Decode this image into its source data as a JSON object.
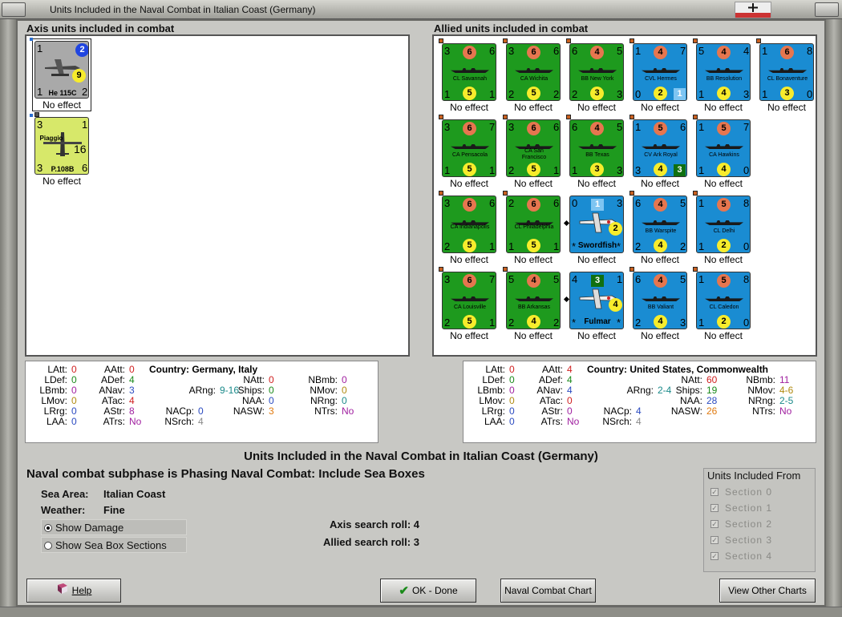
{
  "window": {
    "title": "Units Included in the Naval Combat in Italian Coast (Germany)"
  },
  "axis_section": {
    "title": "Axis units included in combat"
  },
  "allied_section": {
    "title": "Allied units included in combat"
  },
  "axis_units": [
    {
      "name": "He 115C",
      "tl": "1",
      "tr": "2",
      "bl": "1",
      "br": "2",
      "center": "9",
      "status": "No effect"
    },
    {
      "name": "P.108B",
      "name2": "Piaggio",
      "tl": "3",
      "tr": "1",
      "bl": "3",
      "br": "6",
      "center": "16",
      "status": "No effect"
    }
  ],
  "allied_units": [
    {
      "name": "CL Savannah",
      "tl": "3",
      "top": "6",
      "tr": "6",
      "bl": "1",
      "bot": "5",
      "br": "1",
      "status": "No effect"
    },
    {
      "name": "CA Wichita",
      "tl": "3",
      "top": "6",
      "tr": "6",
      "bl": "2",
      "bot": "5",
      "br": "2",
      "status": "No effect"
    },
    {
      "name": "BB New York",
      "tl": "6",
      "top": "4",
      "tr": "5",
      "bl": "2",
      "bot": "3",
      "br": "3",
      "status": "No effect"
    },
    {
      "name": "CVL Hermes",
      "tl": "1",
      "top": "4",
      "tr": "7",
      "bl": "0",
      "bot": "2",
      "br": "1",
      "status": "No effect"
    },
    {
      "name": "BB Resolution",
      "tl": "5",
      "top": "4",
      "tr": "4",
      "bl": "1",
      "bot": "4",
      "br": "3",
      "status": "No effect"
    },
    {
      "name": "CL Bonaventure",
      "tl": "1",
      "top": "6",
      "tr": "8",
      "bl": "1",
      "bot": "3",
      "br": "0",
      "status": "No effect"
    },
    {
      "name": "CA Pensacola",
      "tl": "3",
      "top": "6",
      "tr": "7",
      "bl": "1",
      "bot": "5",
      "br": "1",
      "status": "No effect"
    },
    {
      "name": "CA San Francisco",
      "tl": "3",
      "top": "6",
      "tr": "6",
      "bl": "2",
      "bot": "5",
      "br": "1",
      "status": "No effect"
    },
    {
      "name": "BB Texas",
      "tl": "6",
      "top": "4",
      "tr": "5",
      "bl": "1",
      "bot": "3",
      "br": "3",
      "status": "No effect"
    },
    {
      "name": "CV Ark Royal",
      "tl": "1",
      "top": "5",
      "tr": "6",
      "bl": "3",
      "bot": "4",
      "br": "3",
      "status": "No effect"
    },
    {
      "name": "CA Hawkins",
      "tl": "1",
      "top": "5",
      "tr": "7",
      "bl": "1",
      "bot": "4",
      "br": "0",
      "status": "No effect"
    },
    {
      "name": "CA Indianapolis",
      "tl": "3",
      "top": "6",
      "tr": "6",
      "bl": "2",
      "bot": "5",
      "br": "1",
      "status": "No effect"
    },
    {
      "name": "CL Philadelphia",
      "tl": "2",
      "top": "6",
      "tr": "6",
      "bl": "1",
      "bot": "5",
      "br": "1",
      "status": "No effect"
    },
    {
      "name": "Swordfish",
      "tl": "0",
      "top": "1",
      "tr": "3",
      "bl": "*",
      "bot": "2",
      "br": "*",
      "status": "No effect"
    },
    {
      "name": "BB Warspite",
      "tl": "6",
      "top": "4",
      "tr": "5",
      "bl": "2",
      "bot": "4",
      "br": "2",
      "status": "No effect"
    },
    {
      "name": "CL Delhi",
      "tl": "1",
      "top": "5",
      "tr": "8",
      "bl": "1",
      "bot": "2",
      "br": "0",
      "status": "No effect"
    },
    {
      "name": "CA Louisville",
      "tl": "3",
      "top": "6",
      "tr": "7",
      "bl": "2",
      "bot": "5",
      "br": "1",
      "status": "No effect"
    },
    {
      "name": "BB Arkansas",
      "tl": "5",
      "top": "4",
      "tr": "5",
      "bl": "2",
      "bot": "4",
      "br": "2",
      "status": "No effect"
    },
    {
      "name": "Fulmar",
      "tl": "4",
      "top": "3",
      "tr": "1",
      "bl": "*",
      "bot": "4",
      "br": "*",
      "status": "No effect"
    },
    {
      "name": "BB Valiant",
      "tl": "6",
      "top": "4",
      "tr": "5",
      "bl": "2",
      "bot": "4",
      "br": "3",
      "status": "No effect"
    },
    {
      "name": "CL Caledon",
      "tl": "1",
      "top": "5",
      "tr": "8",
      "bl": "1",
      "bot": "2",
      "br": "0",
      "status": "No effect"
    }
  ],
  "axis_stats": {
    "country_label": "Country: Germany, Italy",
    "LAtt": "0",
    "LDef": "0",
    "LBmb": "0",
    "LMov": "0",
    "LRrg": "0",
    "LAA": "0",
    "AAtt": "0",
    "ADef": "4",
    "ANav": "3",
    "ATac": "4",
    "AStr": "8",
    "ATrs": "No",
    "ARng": "9-16",
    "NACp": "0",
    "NSrch": "4",
    "NAtt": "0",
    "Ships": "0",
    "NAA": "0",
    "NASW": "3",
    "NBmb": "0",
    "NMov": "0",
    "NRng": "0",
    "NTrs": "No"
  },
  "allied_stats": {
    "country_label": "Country: United States, Commonwealth",
    "LAtt": "0",
    "LDef": "0",
    "LBmb": "0",
    "LMov": "0",
    "LRrg": "0",
    "LAA": "0",
    "AAtt": "4",
    "ADef": "4",
    "ANav": "4",
    "ATac": "0",
    "AStr": "0",
    "ATrs": "No",
    "ARng": "2-4",
    "NACp": "4",
    "NSrch": "4",
    "NAtt": "60",
    "Ships": "19",
    "NAA": "28",
    "NASW": "26",
    "NBmb": "11",
    "NMov": "4-6",
    "NRng": "2-5",
    "NTrs": "No"
  },
  "heading": "Units Included in the Naval Combat in Italian Coast (Germany)",
  "subphase": "Naval combat subphase is Phasing Naval Combat: Include Sea Boxes",
  "sea_area": {
    "label": "Sea Area:",
    "value": "Italian Coast"
  },
  "weather": {
    "label": "Weather:",
    "value": "Fine"
  },
  "options": {
    "show_damage": "Show Damage",
    "show_sea_box": "Show Sea Box Sections"
  },
  "rolls": {
    "axis": "Axis search roll: 4",
    "allied": "Allied search roll: 3"
  },
  "sections_group": {
    "title": "Units Included From",
    "items": [
      "Section 0",
      "Section 1",
      "Section 2",
      "Section 3",
      "Section 4"
    ]
  },
  "buttons": {
    "help": "Help",
    "ok": "OK - Done",
    "naval_chart": "Naval Combat Chart",
    "other_charts": "View Other Charts"
  },
  "colors": {
    "green_unit": "#1e9a1e",
    "blue_unit": "#1a8cd2",
    "attack_dot": "#e6764f",
    "defense_dot": "#f7ec2c"
  }
}
